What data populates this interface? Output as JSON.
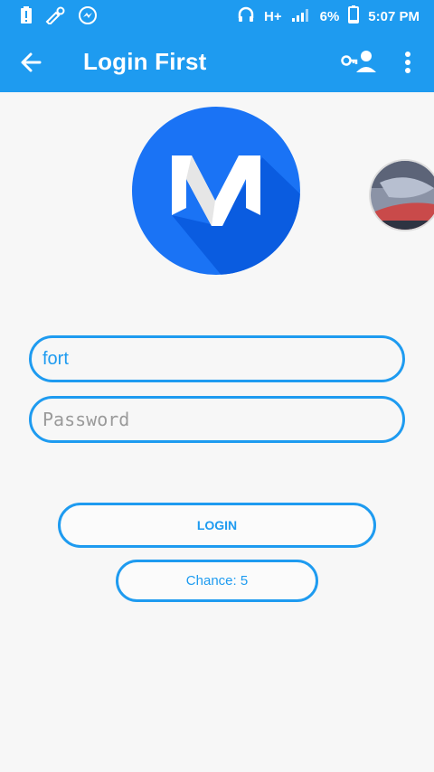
{
  "status_bar": {
    "battery_percent": "6%",
    "network_type": "H+",
    "time": "5:07 PM",
    "icons": [
      "battery-alert-icon",
      "cricket-icon",
      "messenger-icon",
      "headphones-icon",
      "signal-icon",
      "battery-icon"
    ]
  },
  "app_bar": {
    "title": "Login First",
    "color": "#1e9bf0",
    "icons": [
      "back-arrow-icon",
      "account-key-icon",
      "more-vert-icon"
    ]
  },
  "logo": {
    "letter": "M",
    "circle_color": "#1a73f5",
    "shadow_color": "#0a5ce0"
  },
  "form": {
    "username_value": "fort",
    "password_placeholder": "Password"
  },
  "buttons": {
    "login_label": "LOGIN",
    "chance_label": "Chance: 5"
  }
}
